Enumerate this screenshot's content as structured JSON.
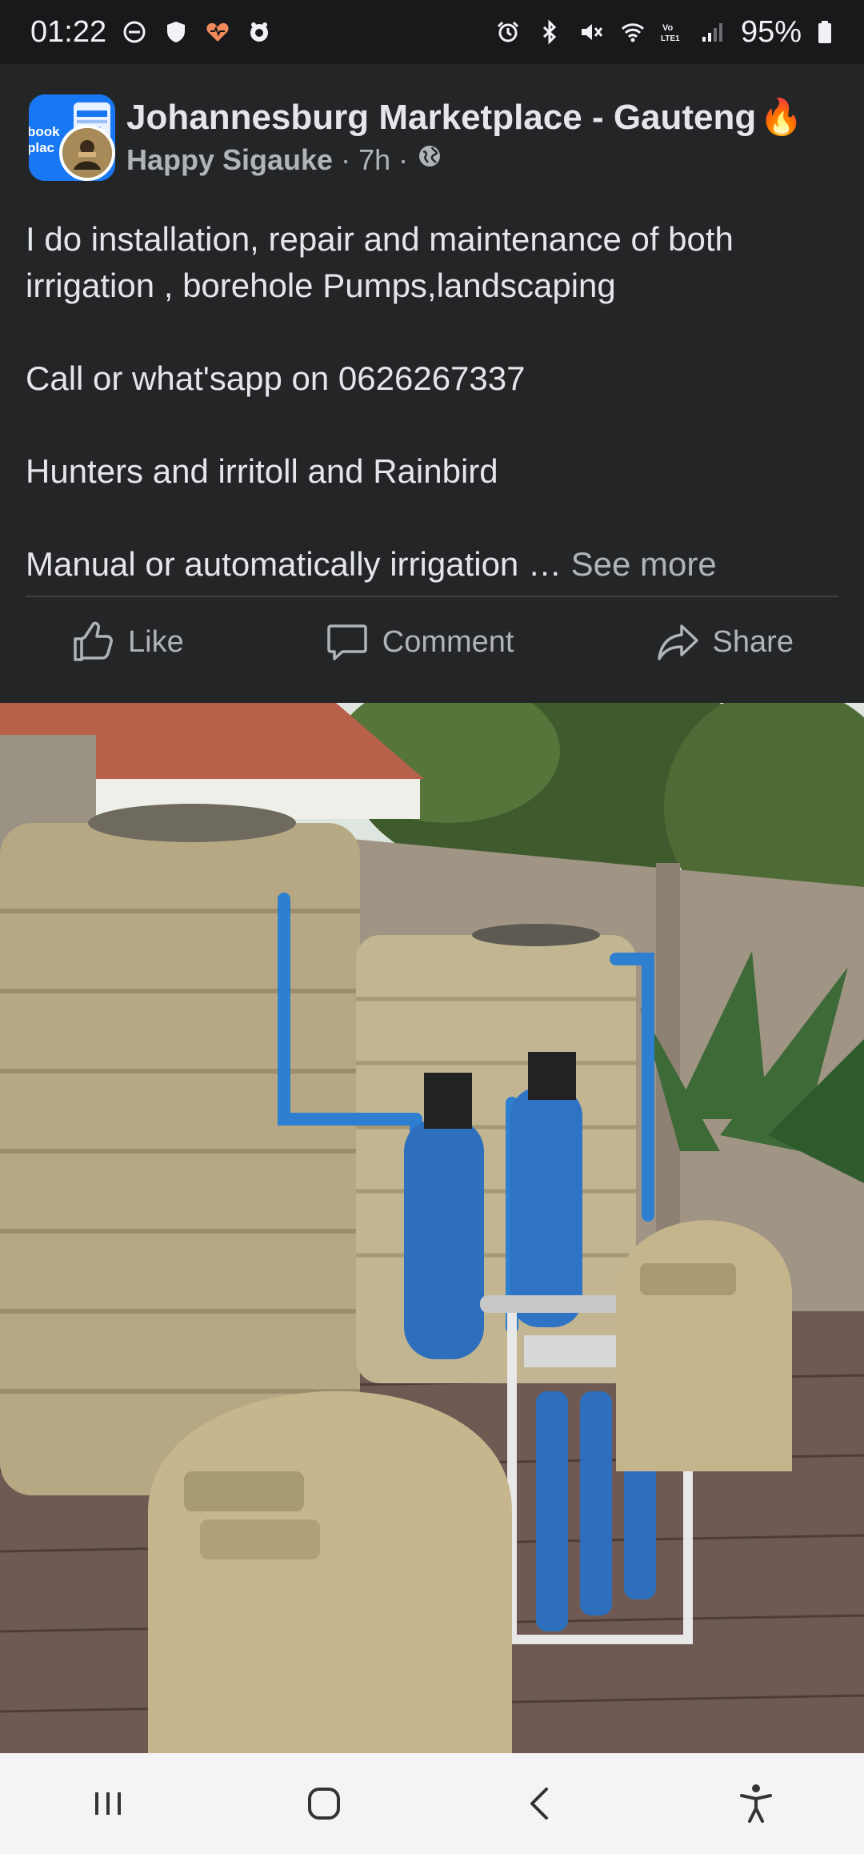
{
  "status_bar": {
    "time": "01:22",
    "battery": "95%",
    "left_icons": [
      "do-not-disturb-icon",
      "shield-icon",
      "health-heart-icon",
      "app-notification-icon"
    ],
    "right_icons": [
      "alarm-icon",
      "bluetooth-icon",
      "mute-icon",
      "wifi-icon",
      "volte-lte-icon",
      "signal-icon",
      "battery-icon"
    ],
    "volte_label": "Vo\nLTE1"
  },
  "post": {
    "group_name": "Johannesburg Marketplace - Gauteng",
    "group_emoji": "🔥",
    "author": "Happy Sigauke",
    "time_ago": "7h",
    "separator": "·",
    "privacy_icon": "globe-icon",
    "text": {
      "line1": "I do installation, repair and maintenance of both irrigation , borehole Pumps,landscaping",
      "line2": "Call or what'sapp on 0626267337",
      "line3": "Hunters and irritoll and Rainbird",
      "line4": "Manual or automatically irrigation …",
      "see_more": "See more"
    },
    "avatar_text": "book\nplac"
  },
  "actions": {
    "like": "Like",
    "comment": "Comment",
    "share": "Share"
  },
  "image": {
    "description_icon": "photo"
  },
  "navbar": {
    "icons": [
      "recent-apps-icon",
      "home-icon",
      "back-icon",
      "accessibility-icon"
    ]
  }
}
